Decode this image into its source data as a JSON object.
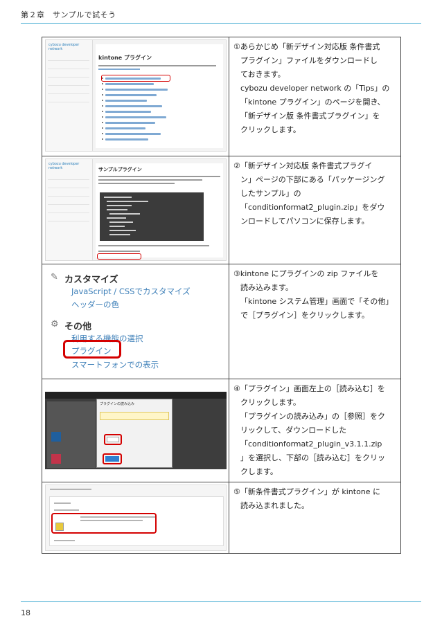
{
  "header": {
    "chapter": "第２章　サンプルで試そう"
  },
  "footer": {
    "page_number": "18"
  },
  "steps": [
    {
      "lines": [
        "①あらかじめ「新デザイン対応版 条件書式",
        "プラグイン」ファイルをダウンロードし",
        "ておきます。",
        "cybozu developer network の「Tips」の",
        "「kintone プラグイン」のページを開き、",
        "「新デザイン版 条件書式プラグイン」を",
        "クリックします。"
      ],
      "screenshot": {
        "logo": "cybozu developer network",
        "page_title": "kintone プラグイン"
      }
    },
    {
      "lines": [
        "②「新デザイン対応版 条件書式プラグイ",
        "ン」ページの下部にある「パッケージング",
        "したサンプル」の",
        "「conditionformat2_plugin.zip」をダウ",
        "ンロードしてパソコンに保存します。"
      ],
      "screenshot": {
        "logo": "cybozu developer network",
        "page_title": "サンプルプラグイン"
      }
    },
    {
      "lines": [
        "③kintone にプラグインの zip ファイルを",
        "読み込みます。",
        "「kintone システム管理」画面で「その他」",
        "で［プラグイン］をクリックします。"
      ],
      "screenshot": {
        "section_customize": "カスタマイズ",
        "link_js_css": "JavaScript / CSSでカスタマイズ",
        "link_header_color": "ヘッダーの色",
        "section_other": "その他",
        "link_features": "利用する機能の選択",
        "link_plugin": "プラグイン",
        "link_smartphone": "スマートフォンでの表示"
      }
    },
    {
      "lines": [
        "④「プラグイン」画面左上の［読み込む］を",
        "クリックします。",
        "「プラグインの読み込み」の［参照］をク",
        "リックして、ダウンロードした",
        "「conditionformat2_plugin_v3.1.1.zip",
        "」を選択し、下部の［読み込む］をクリッ",
        "クします。"
      ],
      "screenshot": {
        "dialog_title": "プラグインの読み込み"
      }
    },
    {
      "lines": [
        "⑤「新条件書式プラグイン」が kintone に",
        "読み込まれました。"
      ],
      "screenshot": {}
    }
  ]
}
